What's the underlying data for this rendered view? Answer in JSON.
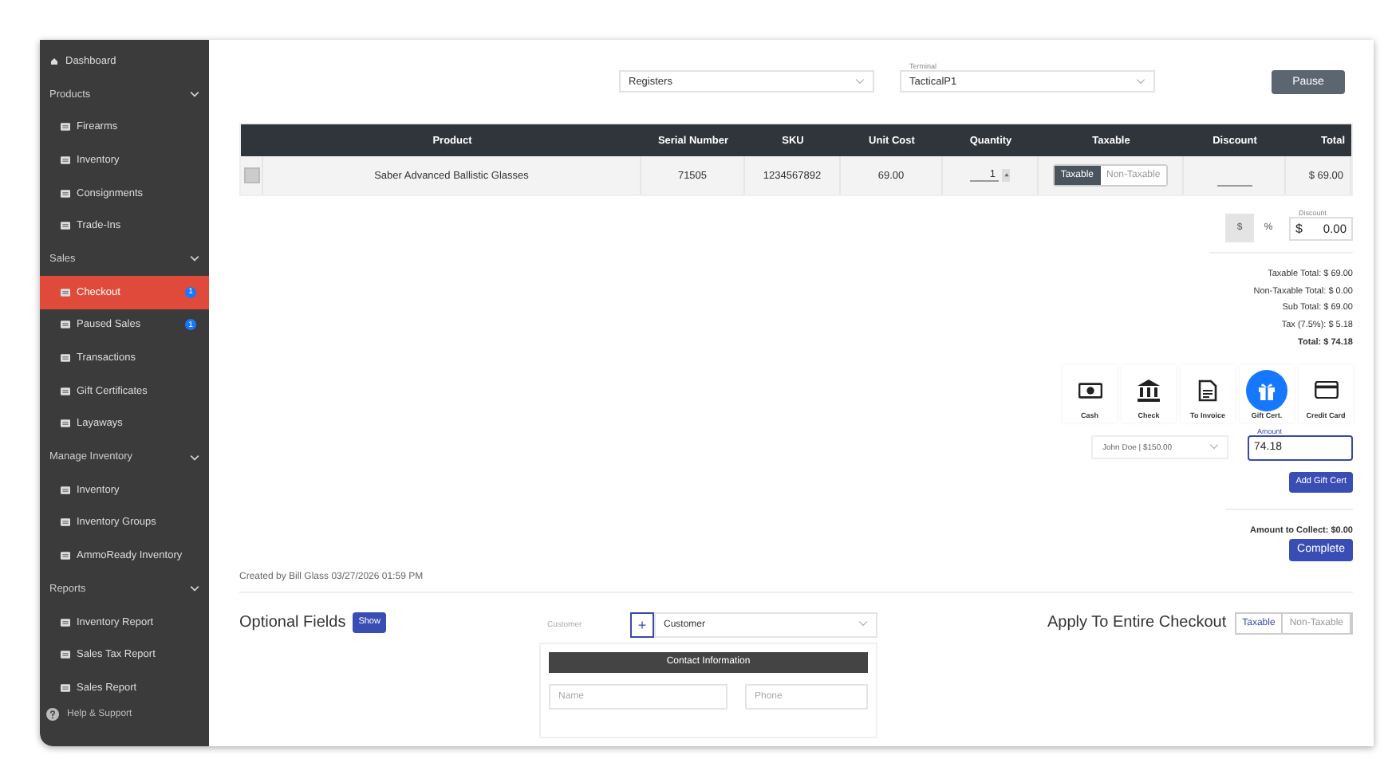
{
  "sidebar": {
    "items": [
      {
        "kind": "link",
        "label": "Dashboard",
        "selected": false
      },
      {
        "kind": "header",
        "label": "Products",
        "expanded": true,
        "children": [
          {
            "label": "Firearms",
            "selected": false
          },
          {
            "label": "Inventory",
            "selected": false
          },
          {
            "label": "Consignments",
            "selected": false
          },
          {
            "label": "Trade-Ins",
            "selected": false
          }
        ]
      },
      {
        "kind": "header",
        "label": "Sales",
        "expanded": true,
        "children": [
          {
            "label": "Checkout",
            "selected": true,
            "badge": "1"
          },
          {
            "label": "Paused Sales",
            "selected": false,
            "badge": "1"
          },
          {
            "label": "Transactions",
            "selected": false
          },
          {
            "label": "Gift Certificates",
            "selected": false
          },
          {
            "label": "Layaways",
            "selected": false
          }
        ]
      },
      {
        "kind": "header",
        "label": "Manage Inventory",
        "expanded": true,
        "children": [
          {
            "label": "Inventory",
            "selected": false
          },
          {
            "label": "Inventory Groups",
            "selected": false
          },
          {
            "label": "AmmoReady Inventory",
            "selected": false
          }
        ]
      },
      {
        "kind": "header",
        "label": "Reports",
        "expanded": true,
        "children": [
          {
            "label": "Inventory Report",
            "selected": false
          },
          {
            "label": "Sales Tax Report",
            "selected": false
          },
          {
            "label": "Sales Report",
            "selected": false
          }
        ]
      }
    ],
    "help": "Help & Support"
  },
  "toolbar": {
    "register": {
      "value": "Registers"
    },
    "terminal": {
      "label": "Terminal",
      "value": "TacticalP1"
    },
    "pause": "Pause"
  },
  "table": {
    "columns": [
      "Product",
      "Serial Number",
      "SKU",
      "Unit Cost",
      "Quantity",
      "Taxable",
      "Discount",
      "Total"
    ],
    "rows": [
      {
        "checked": false,
        "product": "Saber Advanced Ballistic Glasses",
        "serial": "71505",
        "sku": "1234567892",
        "unit_cost": "69.00",
        "quantity": "1",
        "taxable_options": [
          {
            "label": "Taxable",
            "selected": true
          },
          {
            "label": "Non-Taxable",
            "selected": false
          }
        ],
        "total": "$ 69.00"
      }
    ]
  },
  "discount": {
    "modes": [
      {
        "label": "$",
        "selected": true
      },
      {
        "label": "%",
        "selected": false
      }
    ],
    "label": "Discount",
    "currency": "$",
    "value": "0.00"
  },
  "totals": [
    "Taxable Total: $ 69.00",
    "Non-Taxable Total: $ 0.00",
    "Sub Total: $ 69.00",
    "Tax (7.5%): $ 5.18",
    "Total: $ 74.18"
  ],
  "payment_methods": [
    {
      "kind": "cash",
      "label": "Cash",
      "selected": false
    },
    {
      "kind": "check",
      "label": "Check",
      "selected": false
    },
    {
      "kind": "invoice",
      "label": "To Invoice",
      "selected": false
    },
    {
      "kind": "gift",
      "label": "Gift Cert.",
      "selected": true
    },
    {
      "kind": "card",
      "label": "Credit Card",
      "selected": false
    }
  ],
  "gift_card": {
    "value": "John Doe | $150.00",
    "amount_label": "Amount",
    "amount": "74.18",
    "add": "Add Gift Cert"
  },
  "amount_to_collect": "Amount to Collect: $0.00",
  "complete": "Complete",
  "created_by": "Created by Bill Glass 03/27/2026 01:59 PM",
  "optional": {
    "title": "Optional Fields",
    "show": "Show"
  },
  "customer": {
    "label": "Customer",
    "add": "+",
    "value": "Customer",
    "contact_title": "Contact Information",
    "name_placeholder": "Name",
    "phone_placeholder": "Phone"
  },
  "apply": {
    "title": "Apply To Entire Checkout",
    "options": [
      {
        "label": "Taxable",
        "selected": true
      },
      {
        "label": "Non-Taxable",
        "selected": false
      }
    ]
  }
}
